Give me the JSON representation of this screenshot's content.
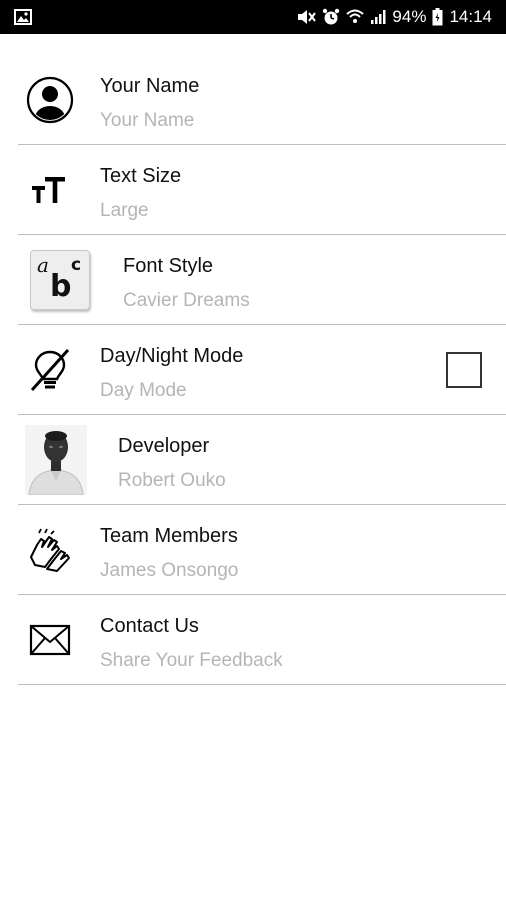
{
  "status_bar": {
    "battery": "94%",
    "time": "14:14",
    "icons": [
      "gallery-icon",
      "mute-icon",
      "alarm-icon",
      "wifi-icon",
      "signal-icon",
      "battery-icon"
    ]
  },
  "settings": {
    "items": [
      {
        "title": "Your Name",
        "subtitle": "Your Name",
        "icon": "user-icon"
      },
      {
        "title": "Text Size",
        "subtitle": "Large",
        "icon": "text-size-icon"
      },
      {
        "title": "Font Style",
        "subtitle": "Cavier Dreams",
        "icon": "font-style-icon"
      },
      {
        "title": "Day/Night Mode",
        "subtitle": "Day Mode",
        "icon": "bulb-off-icon",
        "checked": false
      },
      {
        "title": "Developer",
        "subtitle": "Robert Ouko",
        "icon": "developer-photo"
      },
      {
        "title": "Team Members",
        "subtitle": "James Onsongo",
        "icon": "clapping-hands-icon"
      },
      {
        "title": "Contact Us",
        "subtitle": "Share Your Feedback",
        "icon": "envelope-icon"
      }
    ]
  },
  "colors": {
    "status_bar_bg": "#000000",
    "title_text": "#111111",
    "subtitle_text": "#b5b5b5",
    "divider": "#bdbdbd"
  }
}
